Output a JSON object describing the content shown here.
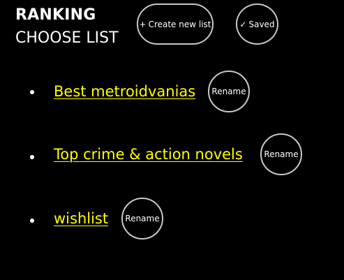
{
  "header": {
    "title": "RANKING",
    "subtitle": "CHOOSE LIST"
  },
  "actions": {
    "create_icon": "+",
    "create_label": "Create new list",
    "saved_icon": "✓",
    "saved_label": "Saved"
  },
  "lists": [
    {
      "name": "Best metroidvanias",
      "rename_label": "Rename"
    },
    {
      "name": "Top crime & action novels",
      "rename_label": "Rename"
    },
    {
      "name": "wishlist",
      "rename_label": "Rename"
    }
  ],
  "colors": {
    "background": "#000000",
    "text": "#ffffff",
    "link": "#ffff00",
    "button_border": "#c8c8c8"
  }
}
